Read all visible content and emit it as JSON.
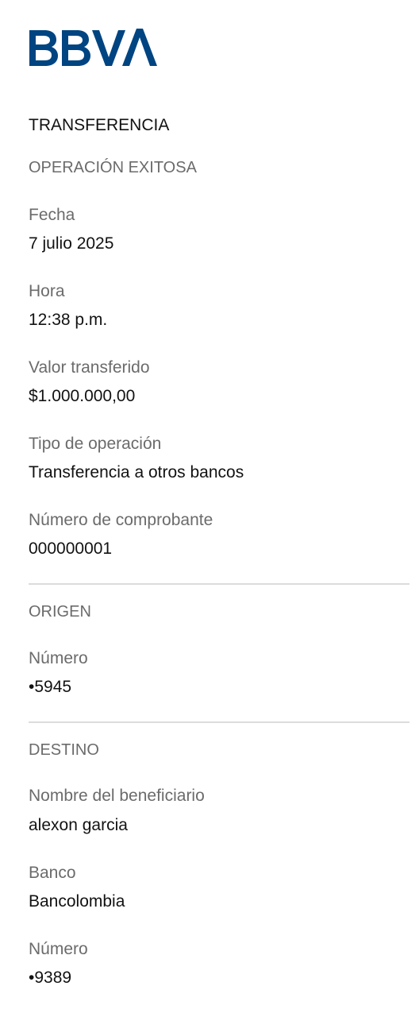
{
  "brand": {
    "logo_text": "BBVA",
    "color": "#004481"
  },
  "receipt": {
    "title": "TRANSFERENCIA",
    "status": "OPERACIÓN EXITOSA",
    "fecha_label": "Fecha",
    "fecha_value": "7 julio 2025",
    "hora_label": "Hora",
    "hora_value": "12:38 p.m.",
    "valor_label": "Valor transferido",
    "valor_value": "$1.000.000,00",
    "tipo_label": "Tipo de operación",
    "tipo_value": "Transferencia a otros bancos",
    "comprobante_label": "Número de comprobante",
    "comprobante_value": "000000001"
  },
  "origen": {
    "section": "ORIGEN",
    "numero_label": "Número",
    "numero_value": "•5945"
  },
  "destino": {
    "section": "DESTINO",
    "beneficiario_label": "Nombre del beneficiario",
    "beneficiario_value": "alexon garcia",
    "banco_label": "Banco",
    "banco_value": "Bancolombia",
    "numero_label": "Número",
    "numero_value": "•9389"
  }
}
